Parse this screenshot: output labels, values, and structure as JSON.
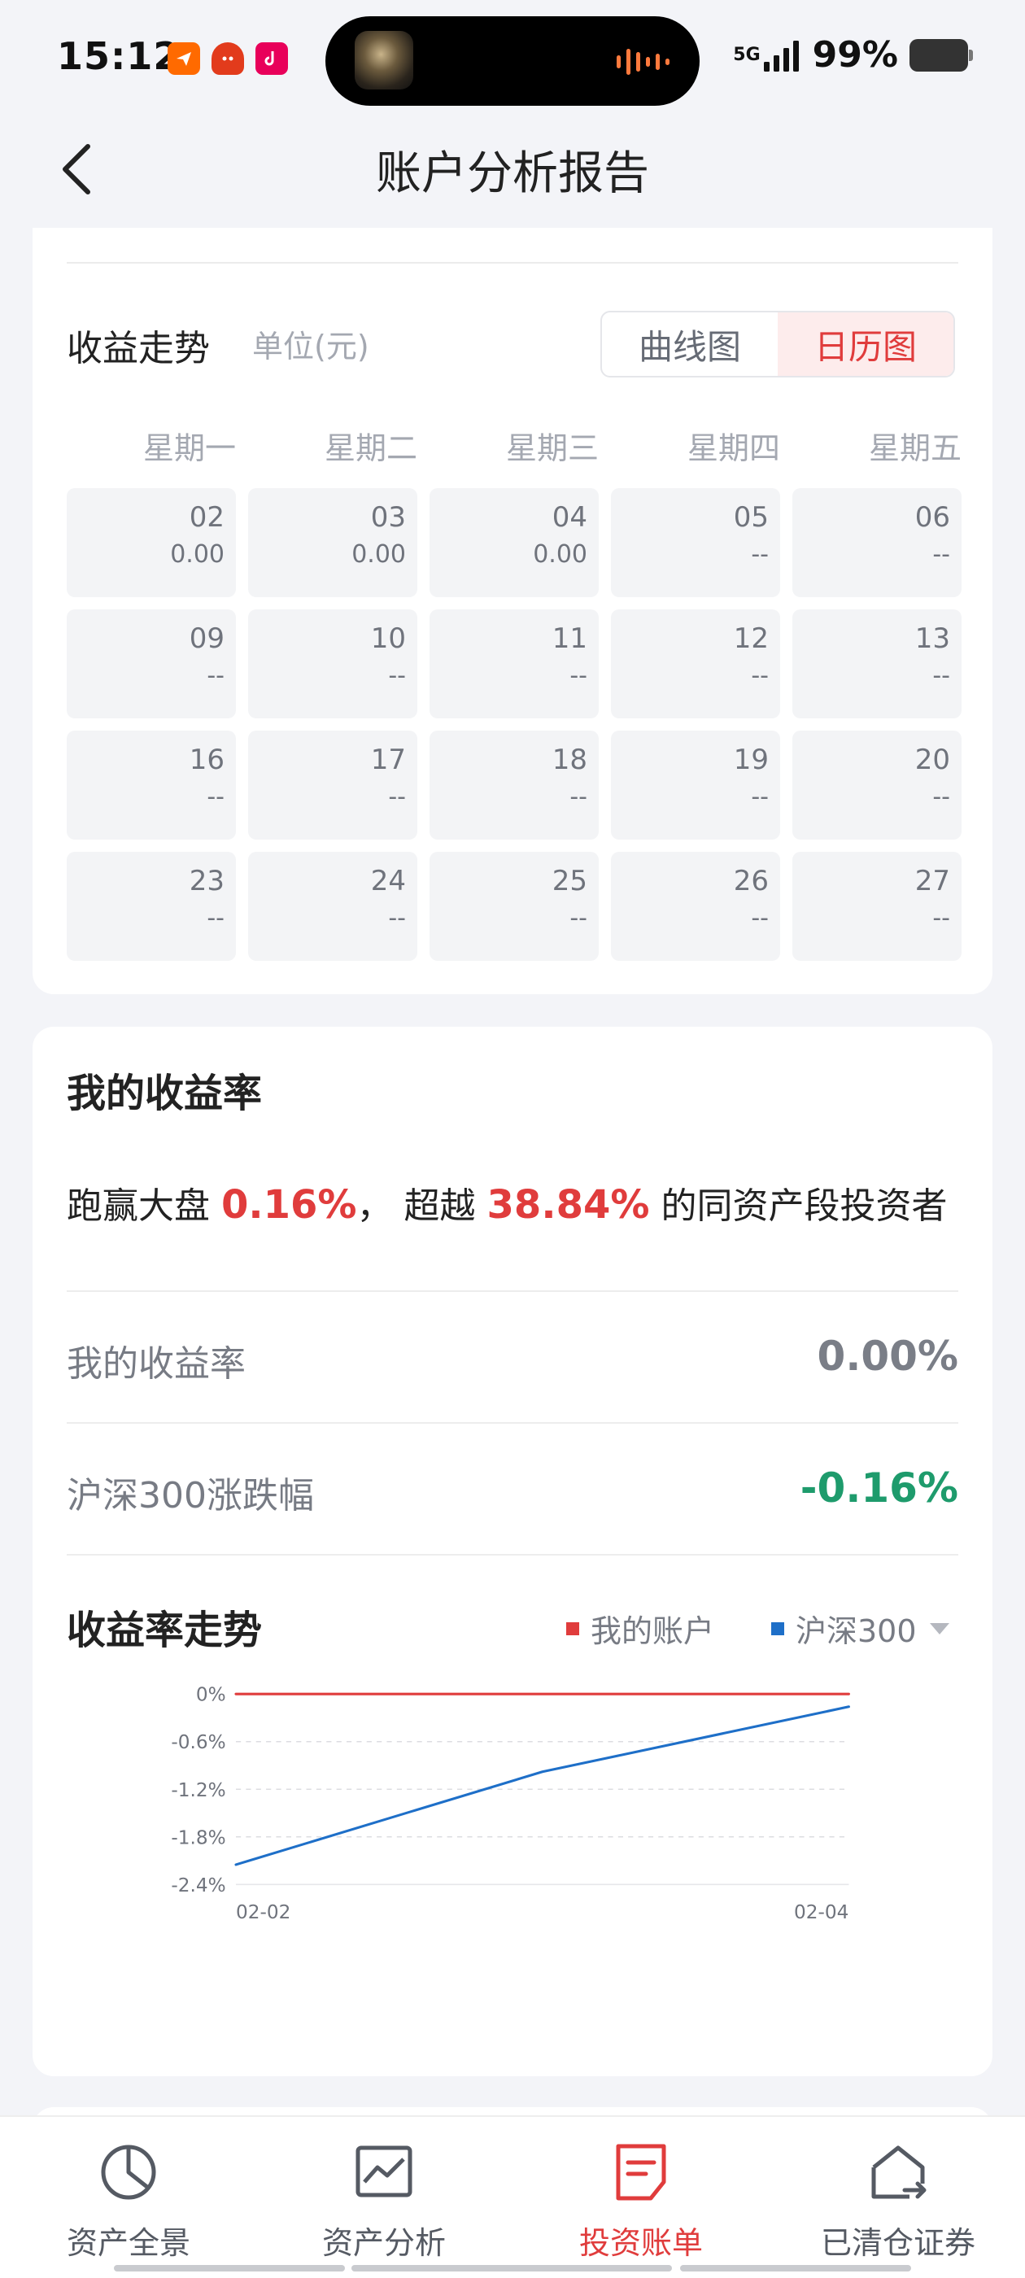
{
  "status_bar": {
    "time": "15:12",
    "network": "5G",
    "battery": "99%",
    "app_icons": [
      "feishu-icon",
      "taobao-icon",
      "douyin-icon"
    ]
  },
  "nav": {
    "title": "账户分析报告",
    "back_icon": "chevron-left-icon"
  },
  "trend_section": {
    "title": "收益走势",
    "unit": "单位(元)",
    "toggle": {
      "options": [
        "曲线图",
        "日历图"
      ],
      "selected": "日历图"
    },
    "weekdays": [
      "星期一",
      "星期二",
      "星期三",
      "星期四",
      "星期五"
    ],
    "calendar": [
      [
        {
          "day": "02",
          "value": "0.00"
        },
        {
          "day": "03",
          "value": "0.00"
        },
        {
          "day": "04",
          "value": "0.00"
        },
        {
          "day": "05",
          "value": "--"
        },
        {
          "day": "06",
          "value": "--"
        }
      ],
      [
        {
          "day": "09",
          "value": "--"
        },
        {
          "day": "10",
          "value": "--"
        },
        {
          "day": "11",
          "value": "--"
        },
        {
          "day": "12",
          "value": "--"
        },
        {
          "day": "13",
          "value": "--"
        }
      ],
      [
        {
          "day": "16",
          "value": "--"
        },
        {
          "day": "17",
          "value": "--"
        },
        {
          "day": "18",
          "value": "--"
        },
        {
          "day": "19",
          "value": "--"
        },
        {
          "day": "20",
          "value": "--"
        }
      ],
      [
        {
          "day": "23",
          "value": "--"
        },
        {
          "day": "24",
          "value": "--"
        },
        {
          "day": "25",
          "value": "--"
        },
        {
          "day": "26",
          "value": "--"
        },
        {
          "day": "27",
          "value": "--"
        }
      ]
    ]
  },
  "return_section": {
    "title": "我的收益率",
    "summary": {
      "prefix": "跑赢大盘",
      "beat_value": "0.16%",
      "middle": "，  超越",
      "percentile": "38.84%",
      "suffix": "的同资产段投资者"
    },
    "rows": [
      {
        "label": "我的收益率",
        "value": "0.00%"
      },
      {
        "label": "沪深300涨跌幅",
        "value": "-0.16%"
      }
    ],
    "trend_title": "收益率走势",
    "legend": [
      {
        "name": "我的账户",
        "color": "#e03c3c"
      },
      {
        "name": "沪深300",
        "color": "#1e6fc8"
      }
    ],
    "dropdown_icon": "triangle-down-icon",
    "colors": {
      "positive": "#e03c3c",
      "negative": "#1e9b6c"
    }
  },
  "chart_data": {
    "type": "line",
    "x": [
      "02-02",
      "02-03",
      "02-04"
    ],
    "x_tick_labels": [
      "02-02",
      "02-04"
    ],
    "y_tick_labels": [
      "0%",
      "-0.6%",
      "-1.2%",
      "-1.8%",
      "-2.4%"
    ],
    "ylim": [
      -2.4,
      0
    ],
    "grid": true,
    "series": [
      {
        "name": "我的账户",
        "color": "#e03c3c",
        "values": [
          0,
          0,
          0
        ]
      },
      {
        "name": "沪深300",
        "color": "#1e6fc8",
        "values": [
          -2.15,
          -0.98,
          -0.16
        ]
      }
    ]
  },
  "tabbar": {
    "tabs": [
      {
        "label": "资产全景",
        "icon": "pie-chart-icon"
      },
      {
        "label": "资产分析",
        "icon": "line-chart-icon"
      },
      {
        "label": "投资账单",
        "icon": "bill-document-icon"
      },
      {
        "label": "已清仓证券",
        "icon": "house-exit-icon"
      }
    ],
    "active": "投资账单"
  }
}
